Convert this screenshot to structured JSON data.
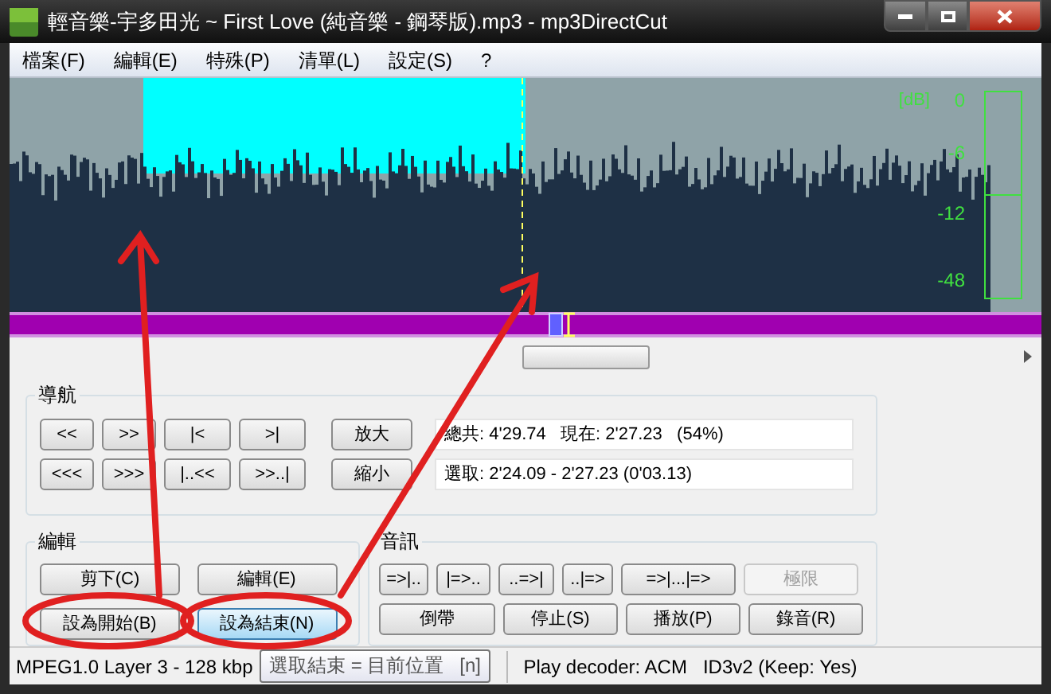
{
  "window": {
    "title": "輕音樂-宇多田光 ~ First Love (純音樂 - 鋼琴版).mp3 - mp3DirectCut"
  },
  "menu": [
    "檔案(F)",
    "編輯(E)",
    "特殊(P)",
    "清單(L)",
    "設定(S)",
    "?"
  ],
  "meter": {
    "unit": "[dB]",
    "labels": [
      "0",
      "-6",
      "-12",
      "-48"
    ]
  },
  "navigation": {
    "title": "導航",
    "buttons": [
      [
        "<<",
        ">>",
        "|<",
        ">|"
      ],
      [
        "<<<",
        ">>>",
        "|..<<",
        ">>..|"
      ]
    ],
    "zoom_buttons": [
      "放大",
      "縮小"
    ],
    "info": [
      "總共: 4'29.74   現在: 2'27.23   (54%)",
      "選取: 2'24.09 - 2'27.23 (0'03.13)"
    ]
  },
  "edit": {
    "title": "編輯",
    "buttons": [
      {
        "label": "剪下(C)",
        "highlighted": false
      },
      {
        "label": "編輯(E)",
        "highlighted": false
      },
      {
        "label": "設為開始(B)",
        "highlighted": false
      },
      {
        "label": "設為結束(N)",
        "highlighted": true
      }
    ]
  },
  "audio": {
    "title": "音訊",
    "top_buttons": [
      {
        "label": "=>|..",
        "disabled": false
      },
      {
        "label": "|=>..",
        "disabled": false
      },
      {
        "label": "..=>|",
        "disabled": false
      },
      {
        "label": "..|=>",
        "disabled": false
      },
      {
        "label": "=>|...|=>",
        "disabled": false
      },
      {
        "label": "極限",
        "disabled": true
      }
    ],
    "bottom_buttons": [
      {
        "label": "倒帶",
        "disabled": false
      },
      {
        "label": "停止(S)",
        "disabled": false
      },
      {
        "label": "播放(P)",
        "disabled": false
      },
      {
        "label": "錄音(R)",
        "disabled": false
      }
    ]
  },
  "status_bar": [
    "MPEG1.0 Layer 3 - 128 kbp",
    "Play decoder: ACM   ID3v2 (Keep: Yes)"
  ],
  "tooltip": "選取結束 = 目前位置   [n]"
}
